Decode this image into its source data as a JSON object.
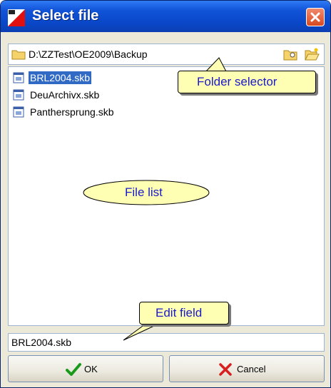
{
  "window": {
    "title": "Select file"
  },
  "folder_bar": {
    "path": "D:\\ZZTest\\OE2009\\Backup",
    "buttons": [
      {
        "name": "browse-folder-button",
        "icon": "folder-search-icon"
      },
      {
        "name": "open-folder-button",
        "icon": "folder-open-icon"
      }
    ]
  },
  "file_list": {
    "items": [
      {
        "name": "BRL2004.skb",
        "selected": true
      },
      {
        "name": "DeuArchivx.skb",
        "selected": false
      },
      {
        "name": "Panthersprung.skb",
        "selected": false
      }
    ]
  },
  "edit_field": {
    "value": "BRL2004.skb"
  },
  "buttons": {
    "ok_label": "OK",
    "cancel_label": "Cancel"
  },
  "callouts": {
    "folder_selector": "Folder selector",
    "file_list": "File list",
    "edit_field": "Edit field"
  },
  "colors": {
    "title_bar": "#0a47c9",
    "selection": "#316ac5",
    "callout_fill": "#ffffb4",
    "callout_text": "#1a1ac8"
  }
}
